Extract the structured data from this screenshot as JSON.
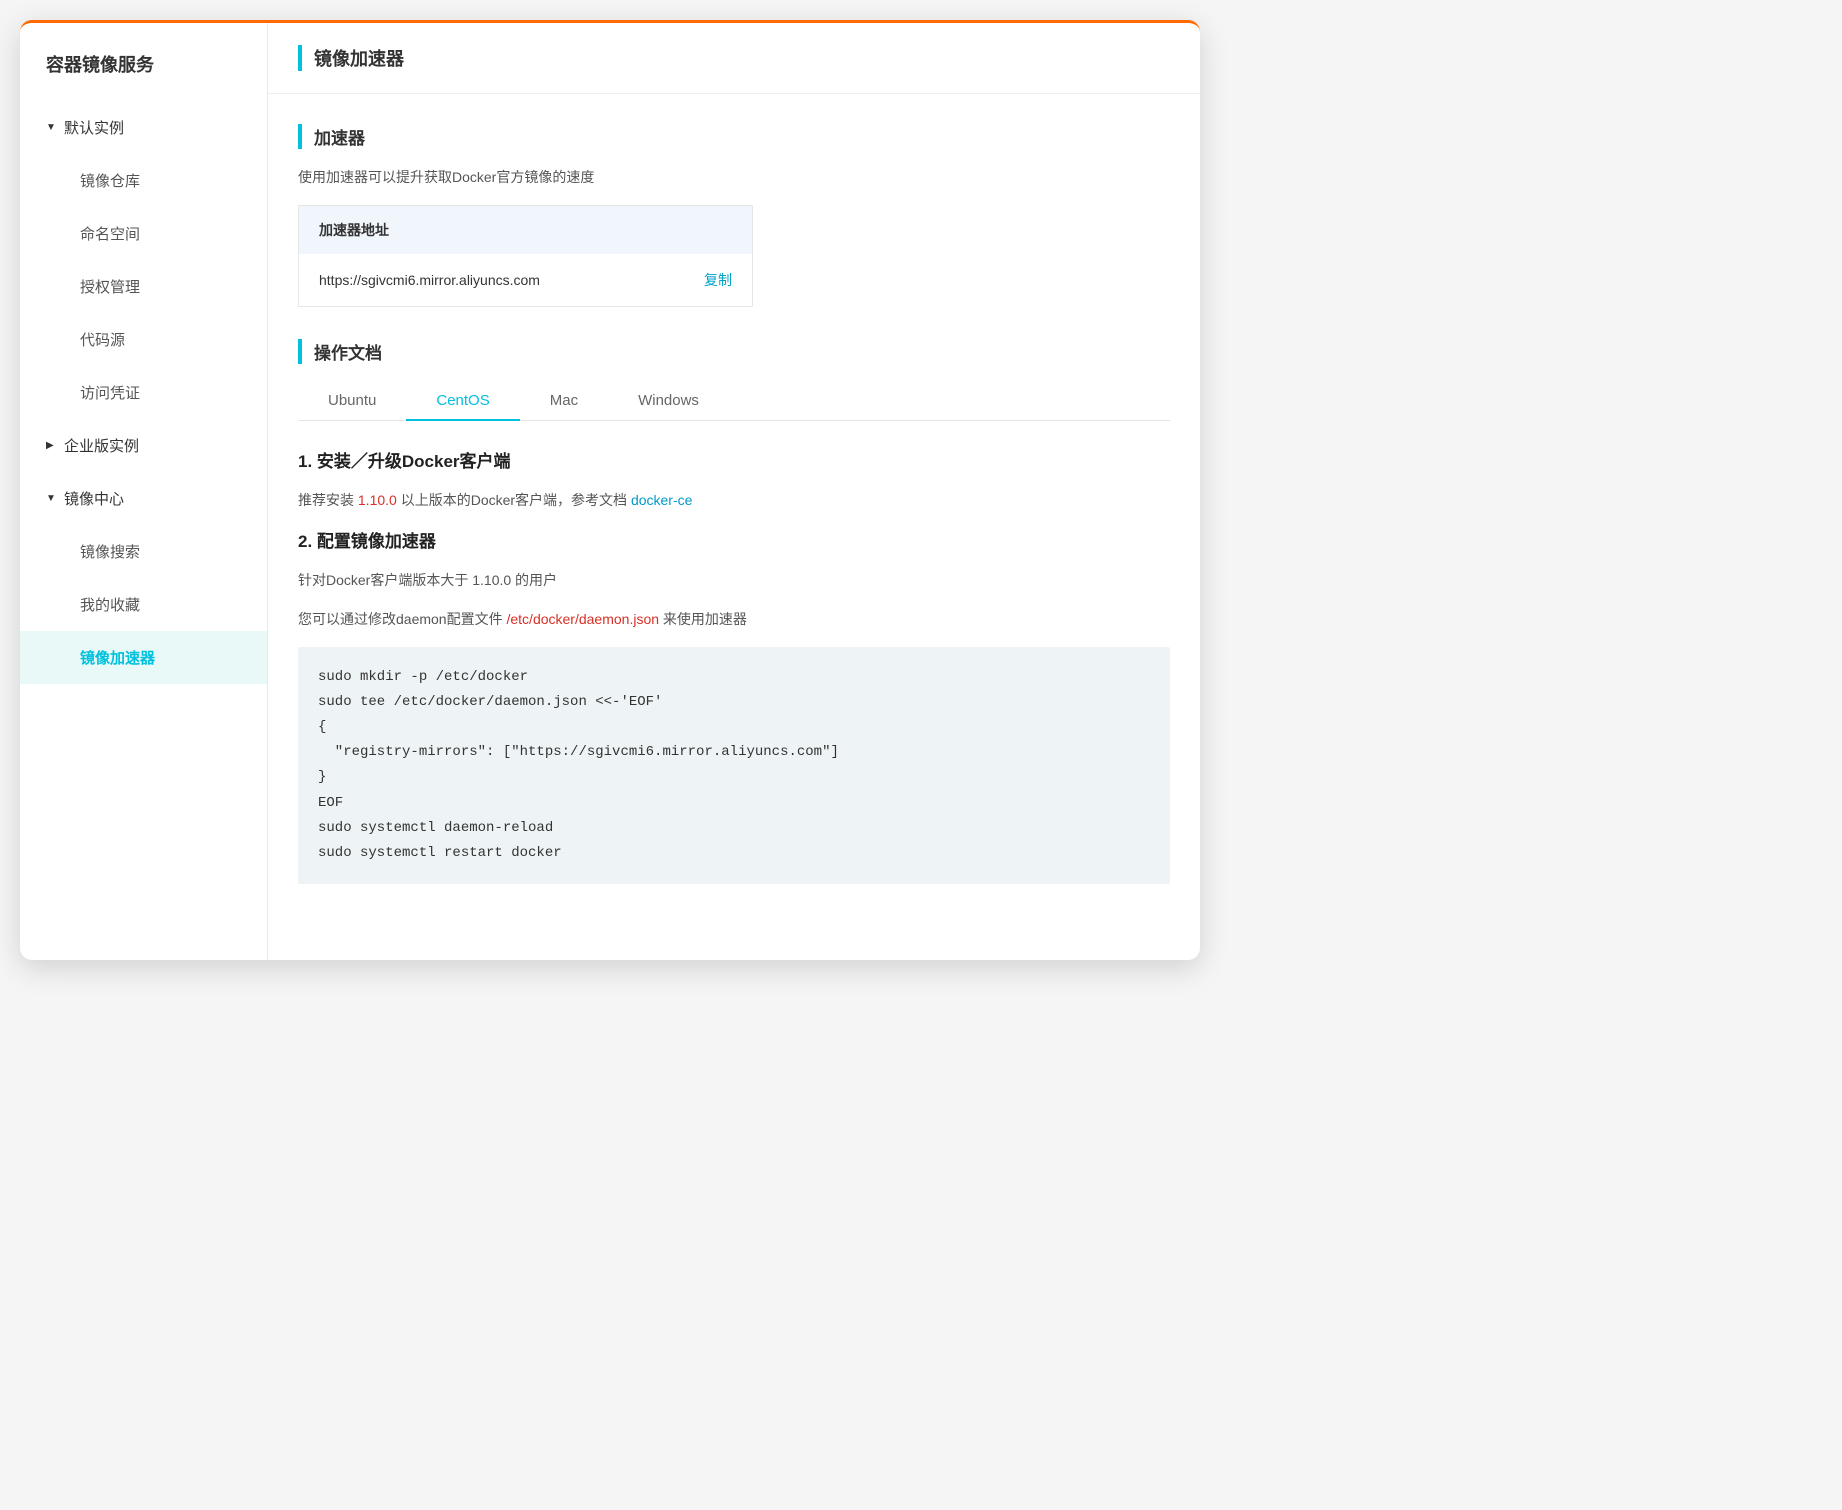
{
  "sidebar": {
    "title": "容器镜像服务",
    "groups": [
      {
        "label": "默认实例",
        "expanded": true,
        "children": [
          {
            "label": "镜像仓库"
          },
          {
            "label": "命名空间"
          },
          {
            "label": "授权管理"
          },
          {
            "label": "代码源"
          },
          {
            "label": "访问凭证"
          }
        ]
      },
      {
        "label": "企业版实例",
        "expanded": false,
        "children": []
      },
      {
        "label": "镜像中心",
        "expanded": true,
        "children": [
          {
            "label": "镜像搜索"
          },
          {
            "label": "我的收藏"
          },
          {
            "label": "镜像加速器",
            "active": true
          }
        ]
      }
    ]
  },
  "header": {
    "title": "镜像加速器"
  },
  "accelerator": {
    "section_title": "加速器",
    "desc": "使用加速器可以提升获取Docker官方镜像的速度",
    "table_head": "加速器地址",
    "address": "https://sgivcmi6.mirror.aliyuncs.com",
    "copy": "复制"
  },
  "docs": {
    "section_title": "操作文档",
    "tabs": [
      "Ubuntu",
      "CentOS",
      "Mac",
      "Windows"
    ],
    "active_tab": "CentOS",
    "step1_title": "1. 安装／升级Docker客户端",
    "step1_pre": "推荐安装 ",
    "step1_ver": "1.10.0",
    "step1_mid": " 以上版本的Docker客户端，参考文档 ",
    "step1_link": "docker-ce",
    "step2_title": "2. 配置镜像加速器",
    "step2_line1": "针对Docker客户端版本大于 1.10.0 的用户",
    "step2_line2_pre": "您可以通过修改daemon配置文件 ",
    "step2_line2_file": "/etc/docker/daemon.json",
    "step2_line2_post": " 来使用加速器",
    "code": "sudo mkdir -p /etc/docker\nsudo tee /etc/docker/daemon.json <<-'EOF'\n{\n  \"registry-mirrors\": [\"https://sgivcmi6.mirror.aliyuncs.com\"]\n}\nEOF\nsudo systemctl daemon-reload\nsudo systemctl restart docker"
  }
}
